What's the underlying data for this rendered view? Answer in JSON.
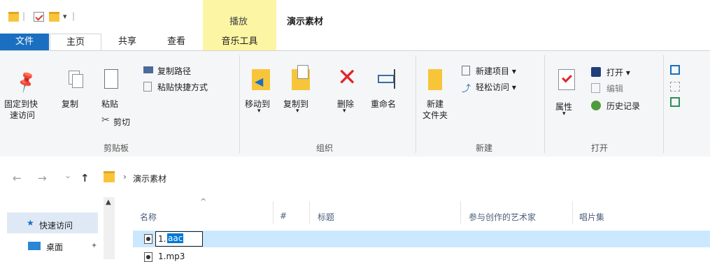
{
  "window": {
    "title": "演示素材",
    "context_tab_group": "播放"
  },
  "tabs": [
    {
      "label": "文件"
    },
    {
      "label": "主页"
    },
    {
      "label": "共享"
    },
    {
      "label": "查看"
    },
    {
      "label": "音乐工具"
    }
  ],
  "ribbon": {
    "clipboard": {
      "pin_label_1": "固定到快",
      "pin_label_2": "速访问",
      "copy": "复制",
      "paste": "粘贴",
      "copy_path": "复制路径",
      "paste_shortcut": "粘贴快捷方式",
      "cut": "剪切",
      "group": "剪贴板"
    },
    "organize": {
      "move_to": "移动到",
      "copy_to": "复制到",
      "delete": "删除",
      "rename": "重命名",
      "group": "组织"
    },
    "new": {
      "new_folder_1": "新建",
      "new_folder_2": "文件夹",
      "new_item": "新建项目 ▾",
      "easy_access": "轻松访问 ▾",
      "group": "新建"
    },
    "open": {
      "properties": "属性",
      "open": "打开 ▾",
      "edit": "编辑",
      "history": "历史记录",
      "group": "打开"
    }
  },
  "address": {
    "back": "←",
    "forward": "→",
    "recent": "⌄",
    "up": "↑",
    "crumb": "演示素材"
  },
  "navpane": {
    "items": [
      {
        "label": "快速访问"
      },
      {
        "label": "桌面"
      }
    ]
  },
  "columns": [
    {
      "label": "名称"
    },
    {
      "label": "#"
    },
    {
      "label": "标题"
    },
    {
      "label": "参与创作的艺术家"
    },
    {
      "label": "唱片集"
    }
  ],
  "files": [
    {
      "name_prefix": "1.",
      "name_ext": "aac"
    },
    {
      "name": "1.mp3"
    }
  ],
  "colors": {
    "file_tab": "#1a6fc1",
    "context_tab": "#fcf6a4",
    "selection": "#cce8ff",
    "text_selection": "#0078d7"
  }
}
